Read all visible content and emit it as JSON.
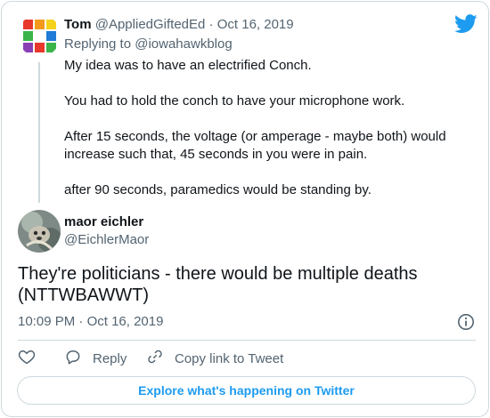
{
  "parent_tweet": {
    "author_name": "Tom",
    "author_handle": "@AppliedGiftedEd",
    "separator": "·",
    "date": "Oct 16, 2019",
    "replying_prefix": "Replying to",
    "replying_handle": "@iowahawkblog",
    "paragraphs": [
      "My idea was to have an electrified Conch.",
      "You had to hold the conch to have your microphone work.",
      "After 15 seconds, the voltage (or amperage - maybe both) would increase such that, 45 seconds in you were in pain.",
      "after 90 seconds, paramedics would be standing by."
    ]
  },
  "main_tweet": {
    "author_name": "maor eichler",
    "author_handle": "@EichlerMaor",
    "text": "They're politicians - there would be multiple deaths (NTTWBAWWT)",
    "time": "10:09 PM",
    "separator": "·",
    "date": "Oct 16, 2019"
  },
  "actions": {
    "like_icon": "heart-icon",
    "reply_label": "Reply",
    "copy_label": "Copy link to Tweet"
  },
  "explore_label": "Explore what's happening on Twitter",
  "colors": {
    "accent": "#1d9bf0",
    "muted_text": "#536471",
    "border": "#cfd9de"
  }
}
